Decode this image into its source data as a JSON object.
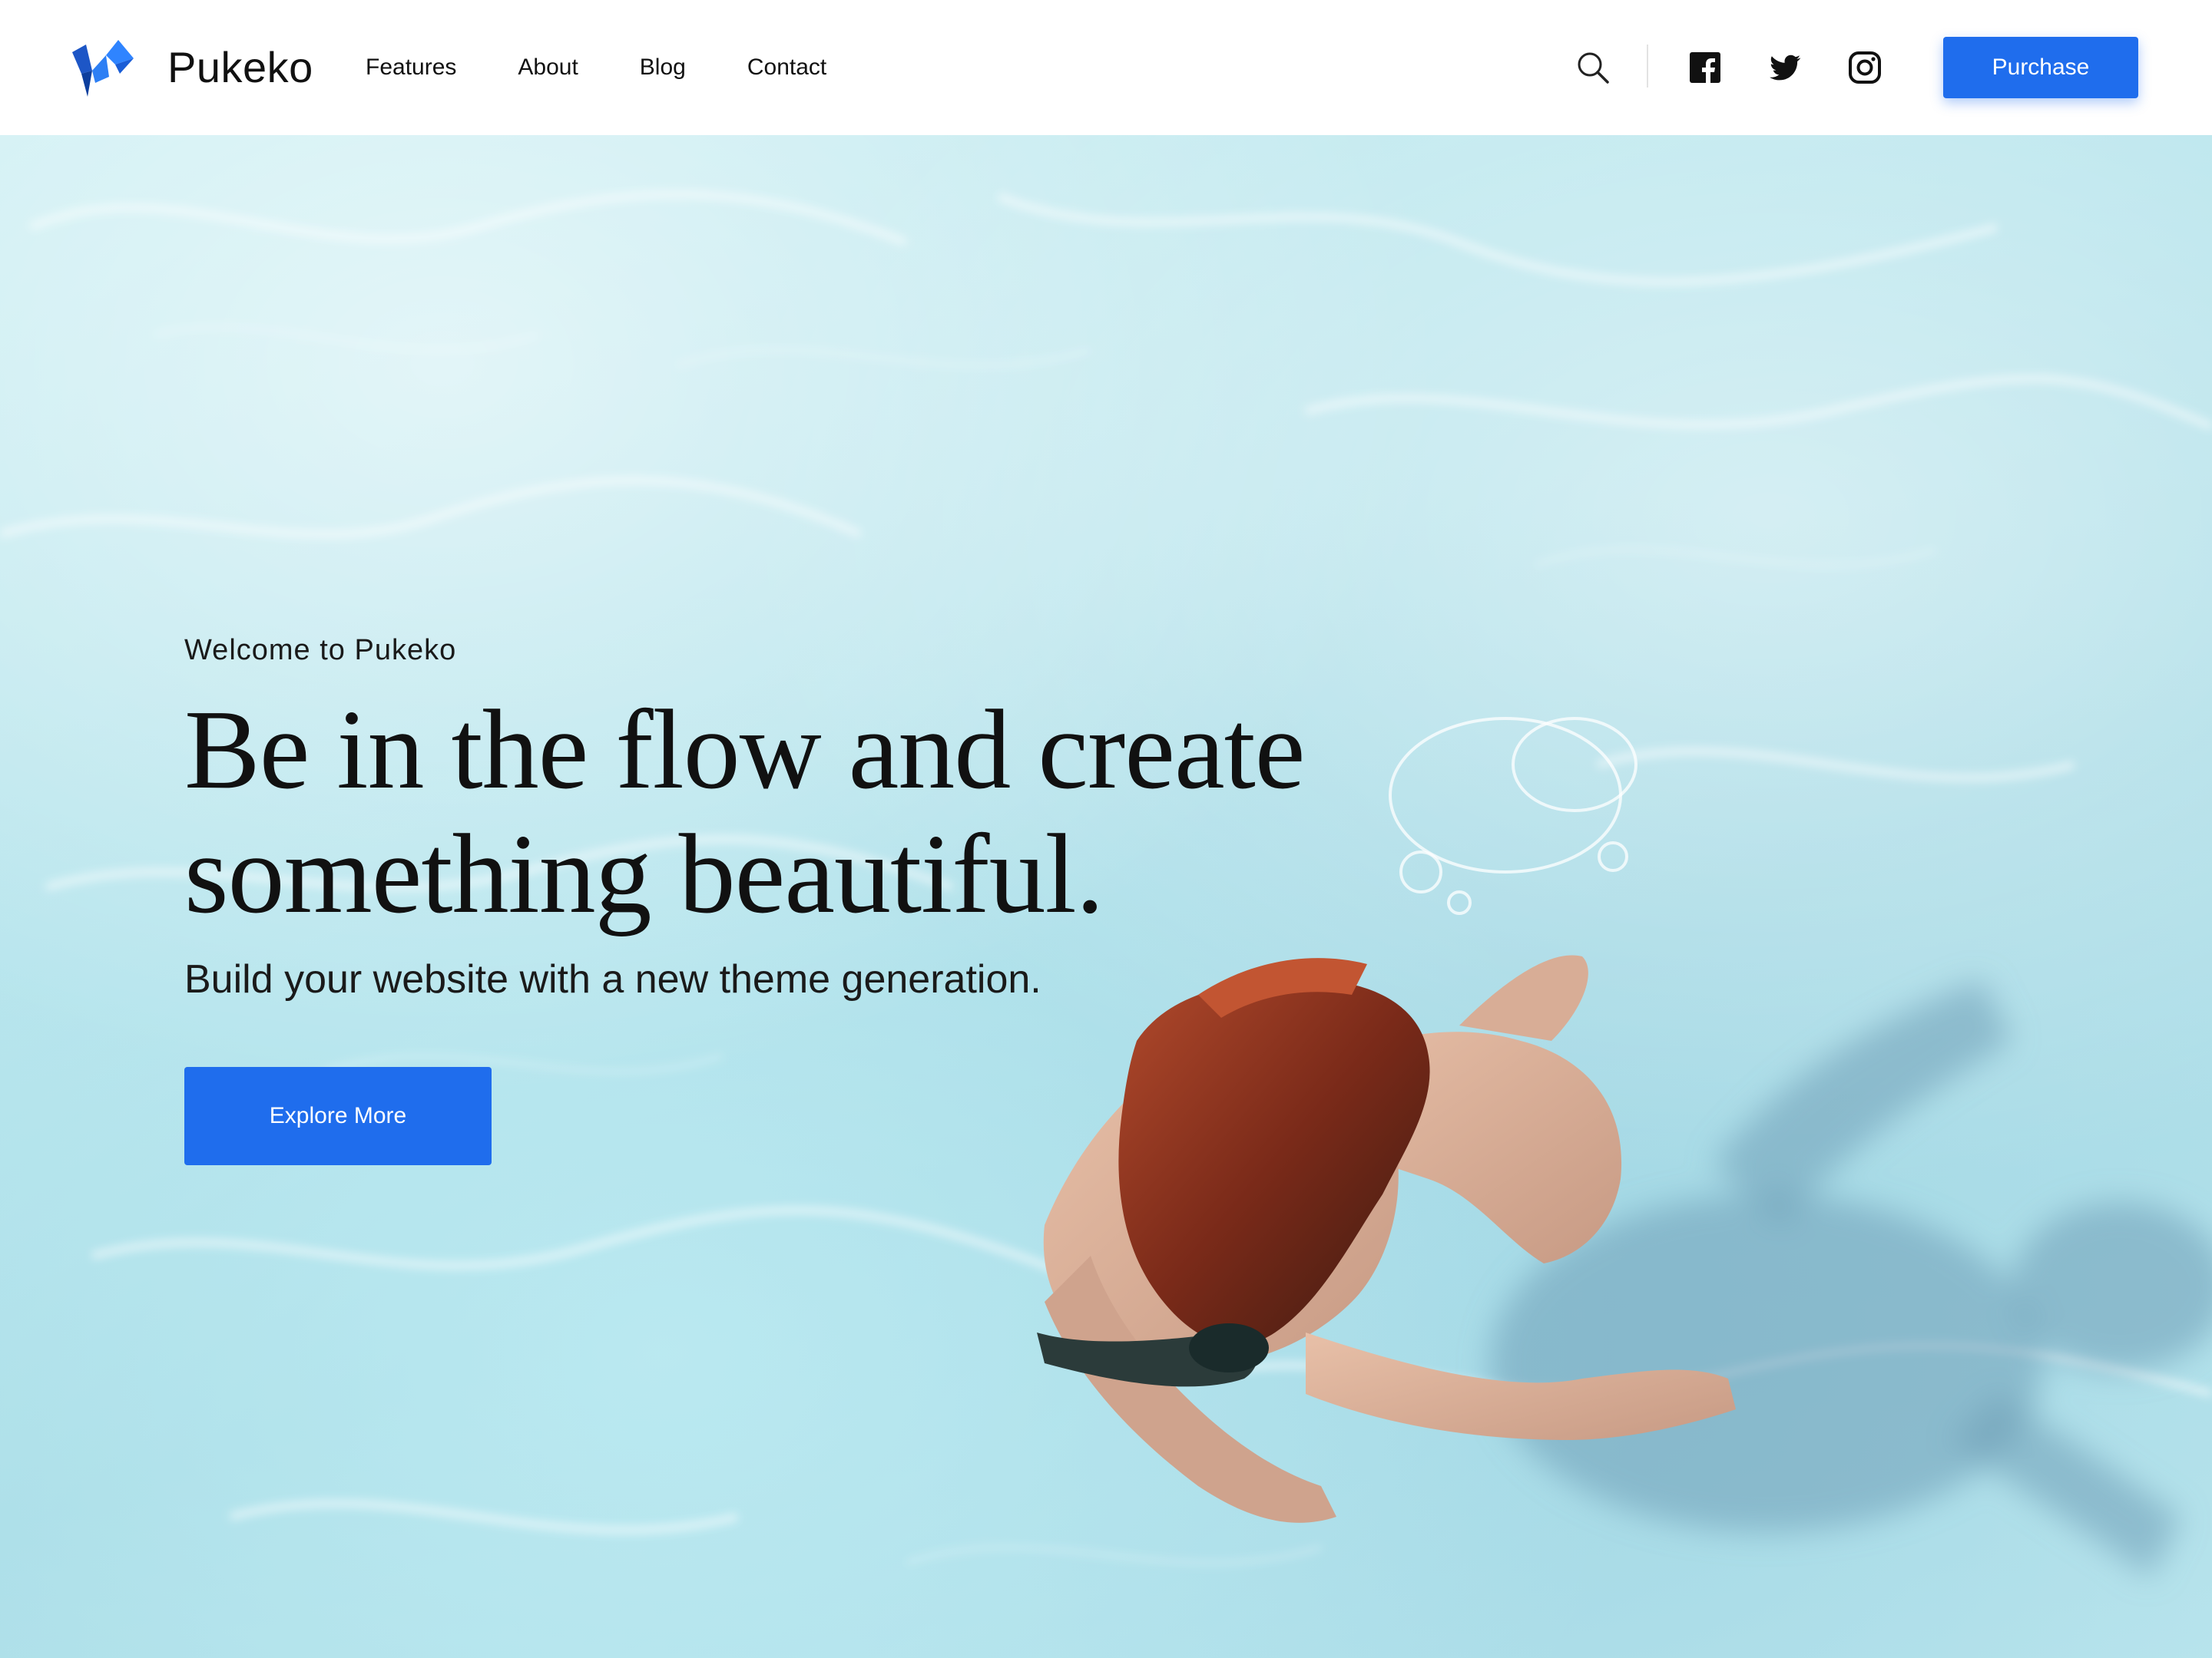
{
  "header": {
    "brand": "Pukeko",
    "nav": [
      {
        "label": "Features"
      },
      {
        "label": "About"
      },
      {
        "label": "Blog"
      },
      {
        "label": "Contact"
      }
    ],
    "icons": [
      "search-icon",
      "facebook-icon",
      "twitter-icon",
      "instagram-icon"
    ],
    "purchase_label": "Purchase"
  },
  "hero": {
    "welcome": "Welcome to Pukeko",
    "headline_line1": "Be in the flow and create",
    "headline_line2": "something beautiful.",
    "subhead": "Build your website with a new theme generation.",
    "cta_label": "Explore More"
  },
  "colors": {
    "accent": "#1f6ded",
    "text": "#111111",
    "water": "#bfe8ef"
  }
}
